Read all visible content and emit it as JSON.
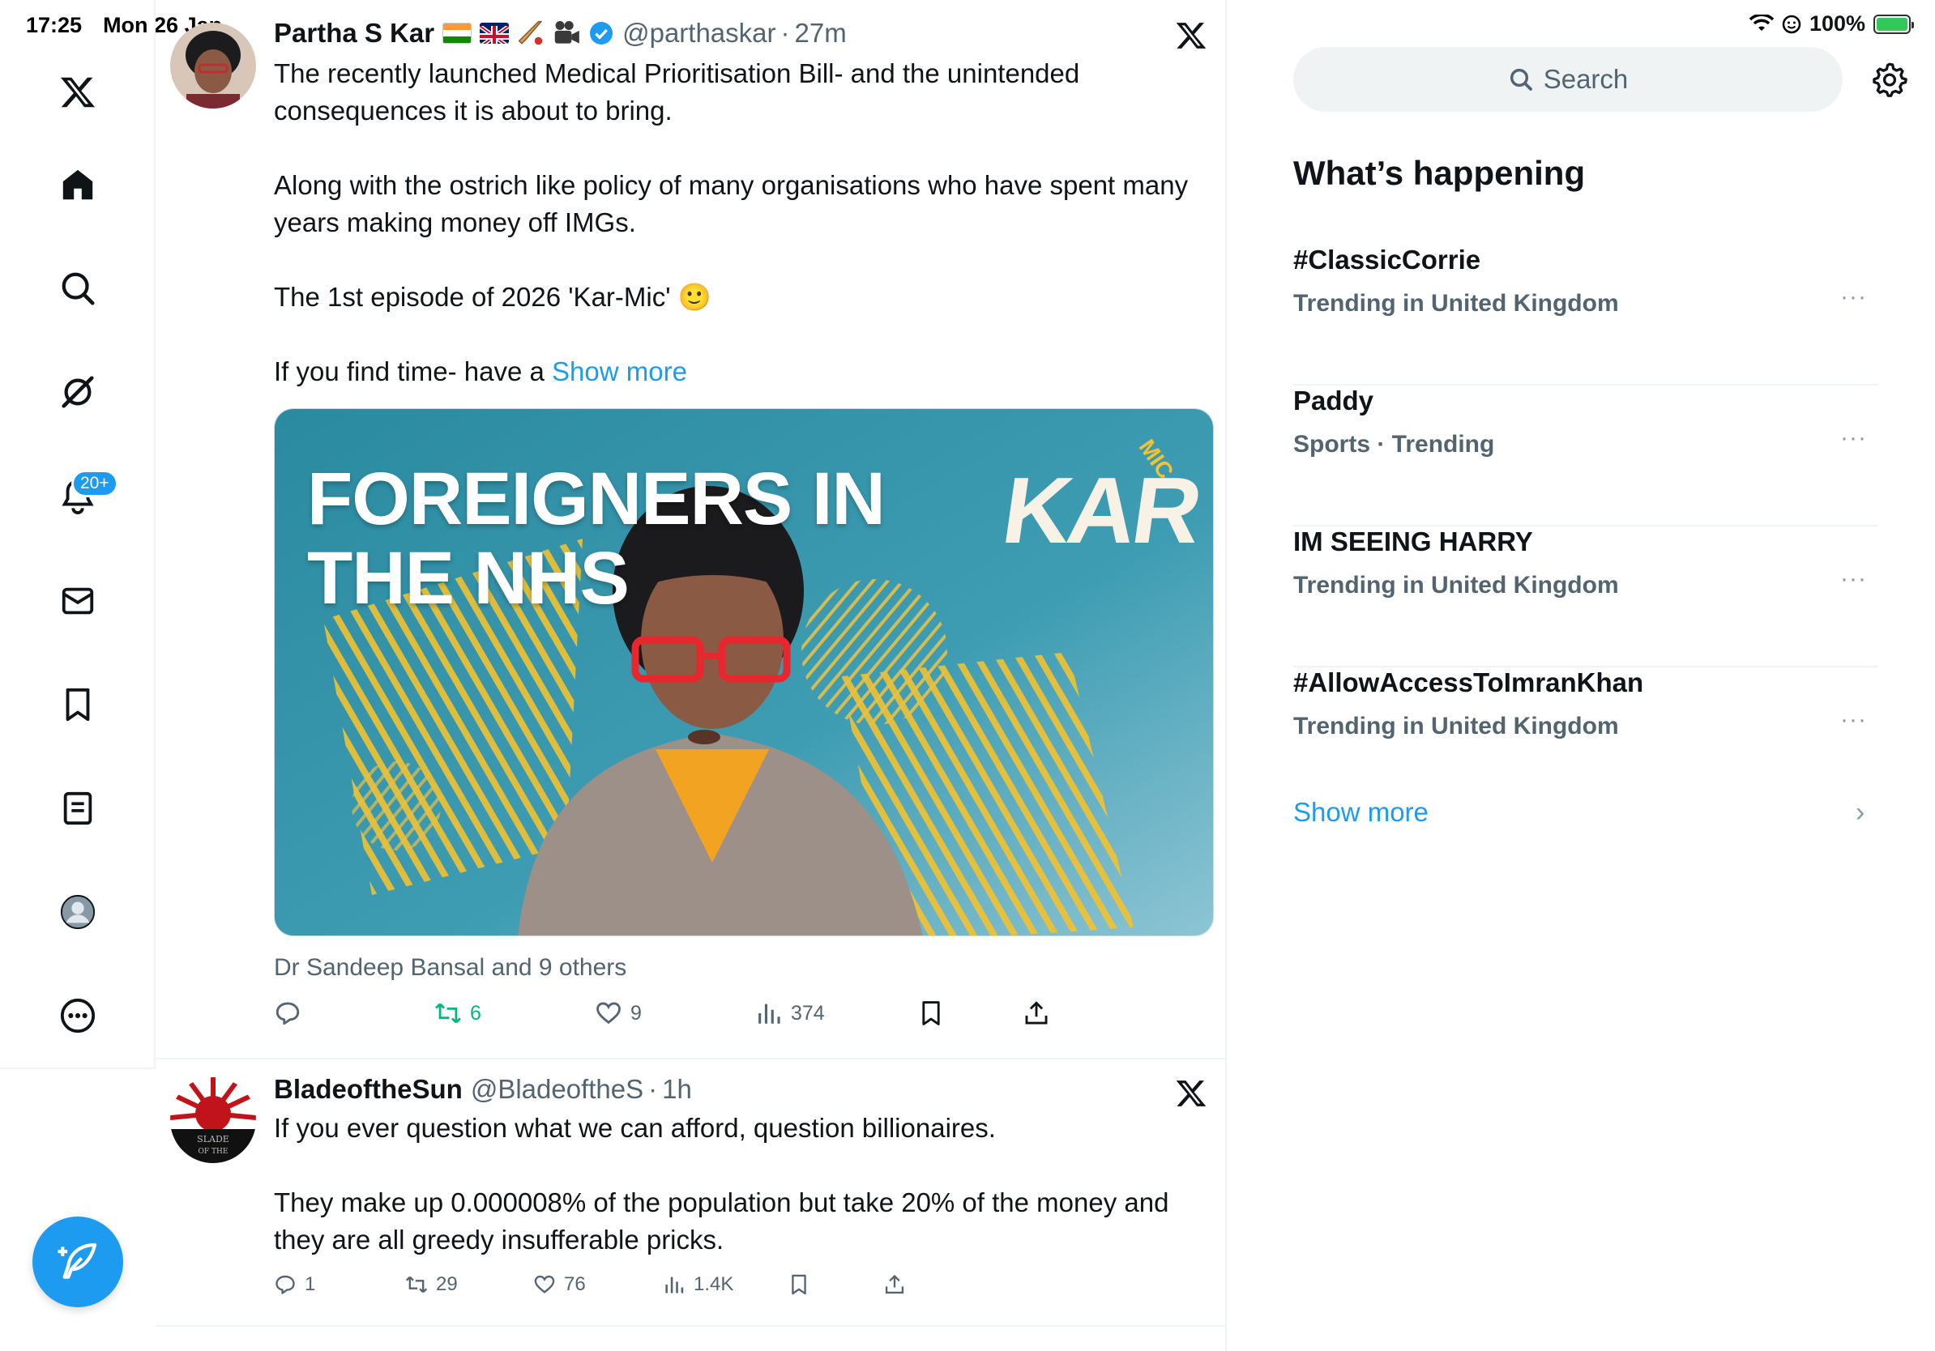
{
  "status_bar": {
    "time": "17:25",
    "date": "Mon 26 Jan",
    "battery": "100%"
  },
  "nav": {
    "items": [
      "X logo",
      "Home",
      "Explore",
      "Grok",
      "Notifications",
      "Messages",
      "Bookmarks",
      "Lists",
      "Profile",
      "More"
    ],
    "notifications_badge": "20+"
  },
  "tweets": [
    {
      "name": "Partha S Kar",
      "handle": "@parthaskar",
      "separator": "·",
      "time": "27m",
      "text_paragraphs": [
        "The recently launched Medical Prioritisation Bill- and the unintended consequences it is about to bring.",
        "Along with the ostrich like policy of many organisations who have spent many years making money off IMGs.",
        "The 1st episode of 2026 'Kar-Mic' 🙂"
      ],
      "text_last": "If you find time- have a ",
      "show_more": "Show more",
      "media": {
        "title_line1": "FOREIGNERS IN",
        "title_line2": "THE NHS",
        "logo": "KAR",
        "logo_sub": "MIC"
      },
      "liked_by": "Dr Sandeep Bansal and 9 others",
      "stats": {
        "replies": "",
        "reposts": "6",
        "likes": "9",
        "views": "374"
      }
    },
    {
      "name": "BladeoftheSun",
      "handle": "@BladeoftheS",
      "separator": "·",
      "time": "1h",
      "text_paragraphs": [
        "If you ever question what we can afford, question billionaires.",
        "They make up 0.000008% of the population but take 20% of the money and they are all greedy insufferable pricks."
      ],
      "stats": {
        "replies": "1",
        "reposts": "29",
        "likes": "76",
        "views": "1.4K"
      }
    }
  ],
  "sidebar": {
    "search_placeholder": "Search",
    "section_title": "What’s happening",
    "trends": [
      {
        "name": "#ClassicCorrie",
        "meta": "Trending in United Kingdom"
      },
      {
        "name": "Paddy",
        "meta": "Sports · Trending"
      },
      {
        "name": "IM SEEING HARRY",
        "meta": "Trending in United Kingdom"
      },
      {
        "name": "#AllowAccessToImranKhan",
        "meta": "Trending in United Kingdom"
      }
    ],
    "more_label": "···",
    "show_more": "Show more"
  },
  "colors": {
    "accent": "#1d9bf0",
    "repost_green": "#00ba7c",
    "muted": "#536471",
    "border": "#eff3f4"
  }
}
